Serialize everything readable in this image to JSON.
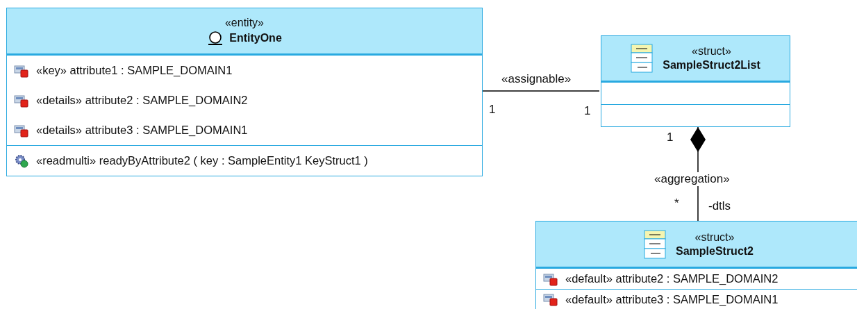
{
  "classes": [
    {
      "kind": "entity",
      "stereotype": "«entity»",
      "name": "EntityOne",
      "compartments": [
        {
          "kind": "list",
          "items": [
            {
              "kind": "attribute",
              "text": "«key» attribute1 : SAMPLE_DOMAIN1"
            },
            {
              "kind": "attribute",
              "text": "«details» attribute2 : SAMPLE_DOMAIN2"
            },
            {
              "kind": "attribute",
              "text": "«details» attribute3 : SAMPLE_DOMAIN1"
            }
          ]
        },
        {
          "kind": "list",
          "items": [
            {
              "kind": "operation",
              "text": "«readmulti» readyByAttribute2 ( key : SampleEntity1 KeyStruct1 )"
            }
          ]
        }
      ]
    },
    {
      "kind": "struct",
      "stereotype": "«struct»",
      "name": "SampleStruct2List",
      "compartments": [
        {
          "kind": "blank"
        },
        {
          "kind": "blank"
        }
      ]
    },
    {
      "kind": "struct",
      "stereotype": "«struct»",
      "name": "SampleStruct2",
      "compartments": [
        {
          "kind": "list",
          "items": [
            {
              "kind": "attribute",
              "text": "«default» attribute2 : SAMPLE_DOMAIN2"
            },
            {
              "kind": "attribute",
              "text": "«default» attribute3 : SAMPLE_DOMAIN1"
            }
          ]
        }
      ]
    }
  ],
  "connectors": [
    {
      "kind": "association",
      "stereotype": "«assignable»",
      "source_multiplicity": "1",
      "target_multiplicity": "1"
    },
    {
      "kind": "composition",
      "stereotype": "«aggregation»",
      "source_multiplicity": "1",
      "target_multiplicity": "*",
      "target_role": "-dtls"
    }
  ]
}
